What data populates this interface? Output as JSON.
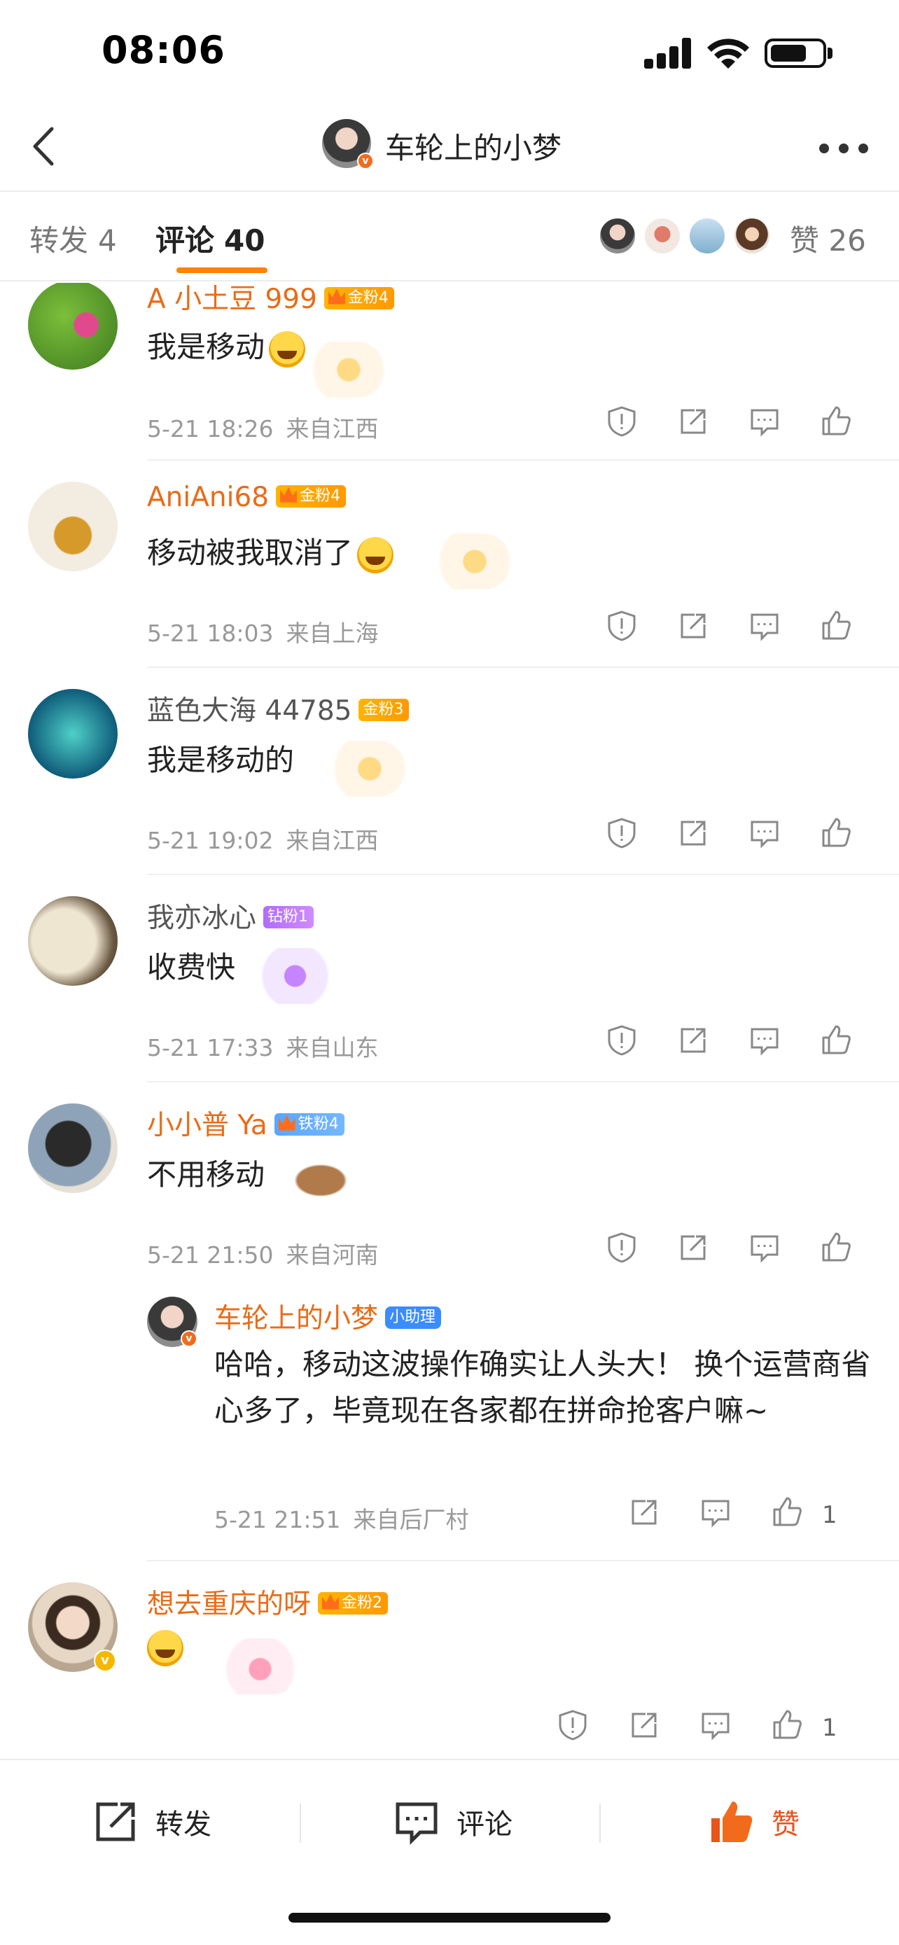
{
  "status_bar": {
    "time": "08:06",
    "battery_level": 0.72
  },
  "header": {
    "title": "车轮上的小梦"
  },
  "tabs": [
    {
      "label": "转发",
      "count": "4"
    },
    {
      "label": "评论",
      "count": "40"
    }
  ],
  "likes": {
    "label": "赞",
    "count": "26"
  },
  "comments": [
    {
      "user": "A 小土豆 999",
      "badge": "金粉4",
      "text": "我是移动",
      "date": "5-21 18:26",
      "location": "来自江西"
    },
    {
      "user": "AniAni68",
      "badge": "金粉4",
      "text": "移动被我取消了",
      "date": "5-21 18:03",
      "location": "来自上海"
    },
    {
      "user": "蓝色大海 44785",
      "badge": "金粉3",
      "text": "我是移动的",
      "date": "5-21 19:02",
      "location": "来自江西"
    },
    {
      "user": "我亦冰心",
      "badge": "钻粉1",
      "text": "收费快",
      "date": "5-21 17:33",
      "location": "来自山东"
    },
    {
      "user": "小小普 Ya",
      "badge": "铁粉4",
      "text": "不用移动",
      "date": "5-21 21:50",
      "location": "来自河南"
    },
    {
      "user": "想去重庆的呀",
      "badge": "金粉2",
      "text": "",
      "date": "",
      "location": "",
      "like_count": "1"
    }
  ],
  "reply": {
    "user": "车轮上的小梦",
    "badge": "小助理",
    "text": "哈哈，移动这波操作确实让人头大！ 换个运营商省心多了，毕竟现在各家都在拼命抢客户嘛~",
    "date": "5-21 21:51",
    "location": "来自后厂村",
    "like_count": "1"
  },
  "bottom_bar": {
    "repost": "转发",
    "comment": "评论",
    "like": "赞"
  },
  "colors": {
    "accent": "#ff8200",
    "username": "#e86c18",
    "like_active": "#e8541a"
  },
  "icons": [
    "back-icon",
    "more-icon",
    "report-icon",
    "share-icon",
    "comment-icon",
    "like-icon"
  ]
}
